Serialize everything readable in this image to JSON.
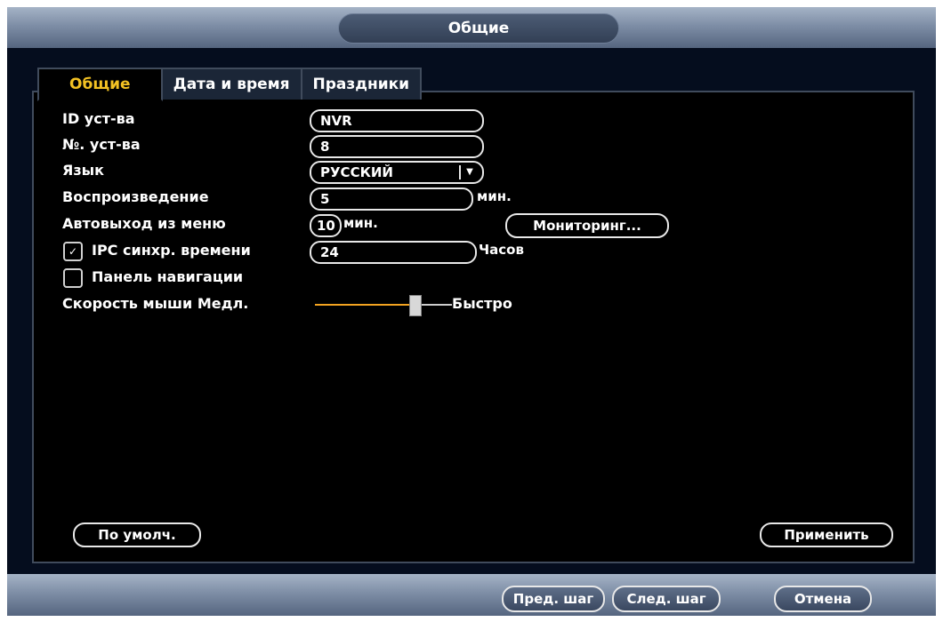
{
  "window": {
    "title": "Общие"
  },
  "tabs": [
    {
      "label": "Общие",
      "active": true
    },
    {
      "label": "Дата и время",
      "active": false
    },
    {
      "label": "Праздники",
      "active": false
    }
  ],
  "form": {
    "device_id": {
      "label": "ID уст-ва",
      "value": "NVR"
    },
    "device_no": {
      "label": "№. уст-ва",
      "value": "8"
    },
    "language": {
      "label": "Язык",
      "value": "РУССКИЙ"
    },
    "playback": {
      "label": "Воспроизведение",
      "value": "5",
      "unit": "мин."
    },
    "auto_logout": {
      "label": "Автовыход из меню",
      "value": "10",
      "unit": "мин.",
      "monitor_button": "Мониторинг..."
    },
    "ipc_sync": {
      "label": "IPC синхр. времени",
      "checked": true,
      "value": "24",
      "unit": "Часов"
    },
    "nav_bar": {
      "label": "Панель навигации",
      "checked": false
    },
    "mouse_speed": {
      "label": "Скорость мыши",
      "slow": "Медл.",
      "fast": "Быстро",
      "level": 0.73
    }
  },
  "buttons": {
    "default": "По умолч.",
    "apply": "Применить"
  },
  "footer": {
    "prev": "Пред. шаг",
    "next": "След. шаг",
    "cancel": "Отмена"
  },
  "colors": {
    "tab_active_text": "#f3c223",
    "slider_accent": "#f3a320"
  }
}
